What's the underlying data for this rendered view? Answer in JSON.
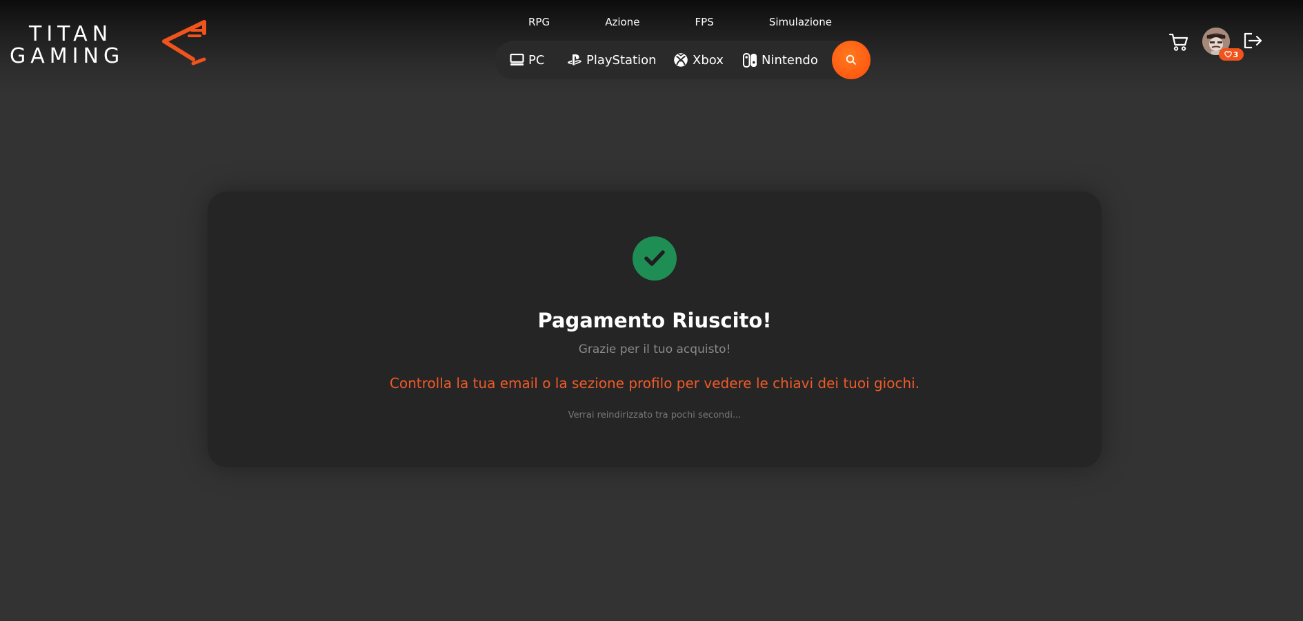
{
  "brand": {
    "name_line1": "TITAN",
    "name_line2": "GAMING",
    "accent_color": "#f05a28"
  },
  "genre_nav": {
    "items": [
      {
        "label": "RPG"
      },
      {
        "label": "Azione"
      },
      {
        "label": "FPS"
      },
      {
        "label": "Simulazione"
      }
    ]
  },
  "platform_nav": {
    "items": [
      {
        "label": "PC",
        "icon": "monitor-icon"
      },
      {
        "label": "PlayStation",
        "icon": "playstation-icon"
      },
      {
        "label": "Xbox",
        "icon": "xbox-icon"
      },
      {
        "label": "Nintendo",
        "icon": "nintendo-switch-icon"
      }
    ],
    "search_icon": "search-icon"
  },
  "user": {
    "cart_icon": "cart-icon",
    "avatar_icon": "avatar",
    "wishlist_count": "3",
    "logout_icon": "logout-icon"
  },
  "confirmation": {
    "icon": "check-icon",
    "icon_color": "#1e8e54",
    "title": "Pagamento Riuscito!",
    "subtitle": "Grazie per il tuo acquisto!",
    "message": "Controlla la tua email o la sezione profilo per vedere le chiavi dei tuoi giochi.",
    "redirect_note": "Verrai reindirizzato tra pochi secondi..."
  }
}
